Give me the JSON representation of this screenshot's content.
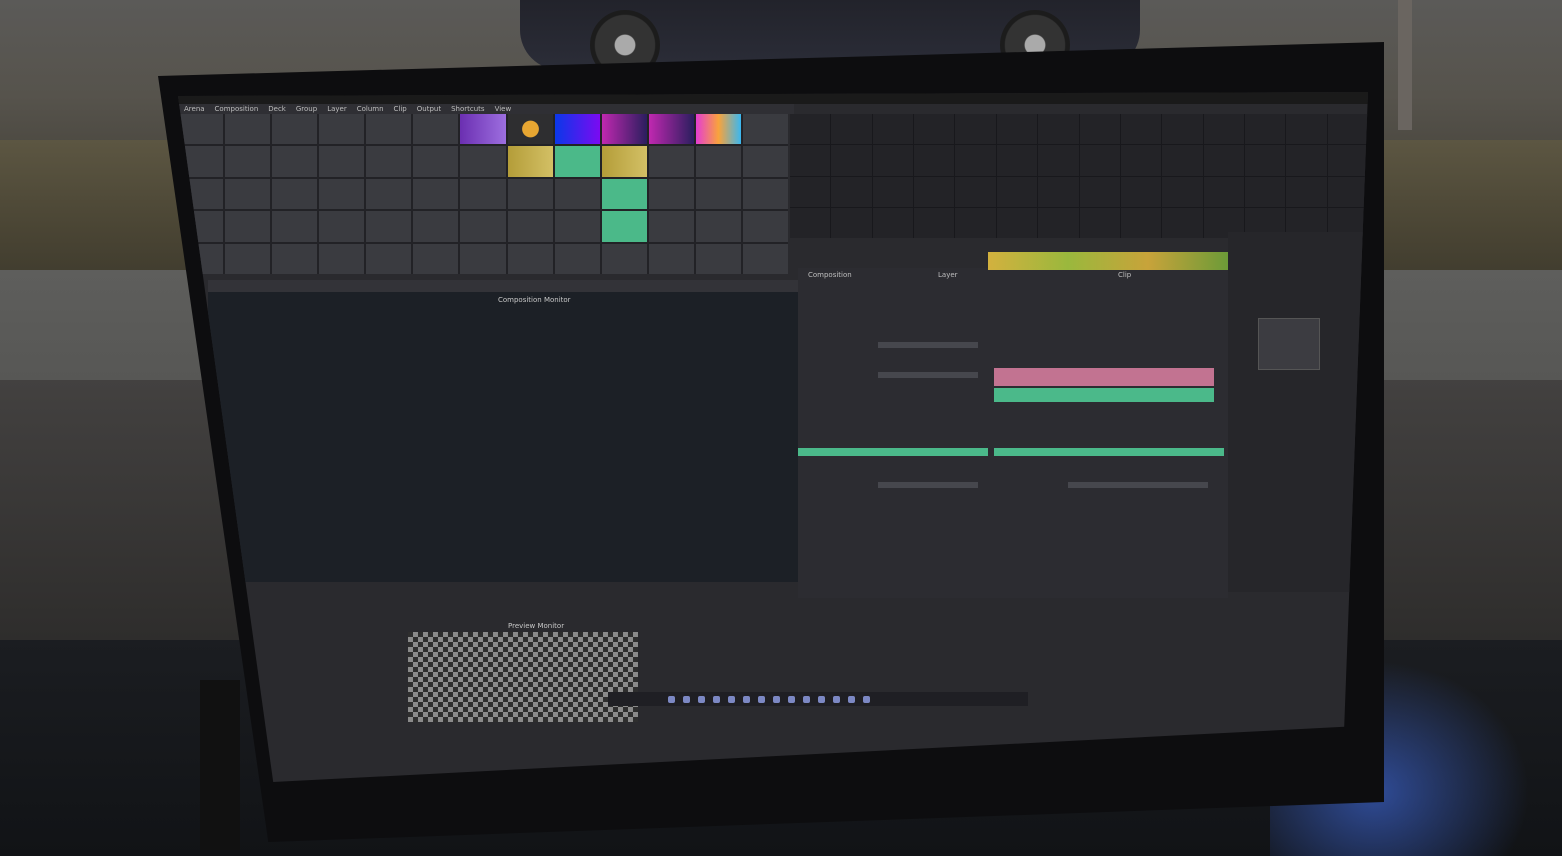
{
  "scene": {
    "description_kind": "photo",
    "colors": {
      "screen_bg": "#2a2a2e",
      "accent_green": "#4bb98a",
      "accent_pink": "#c27391"
    }
  },
  "ui": {
    "menu": [
      "Arena",
      "Composition",
      "Deck",
      "Group",
      "Layer",
      "Column",
      "Clip",
      "Output",
      "Shortcuts",
      "View"
    ],
    "comp_monitor_label": "Composition Monitor",
    "preview_label": "Preview Monitor",
    "panel_tabs": [
      "Composition",
      "Layer",
      "Clip"
    ]
  }
}
